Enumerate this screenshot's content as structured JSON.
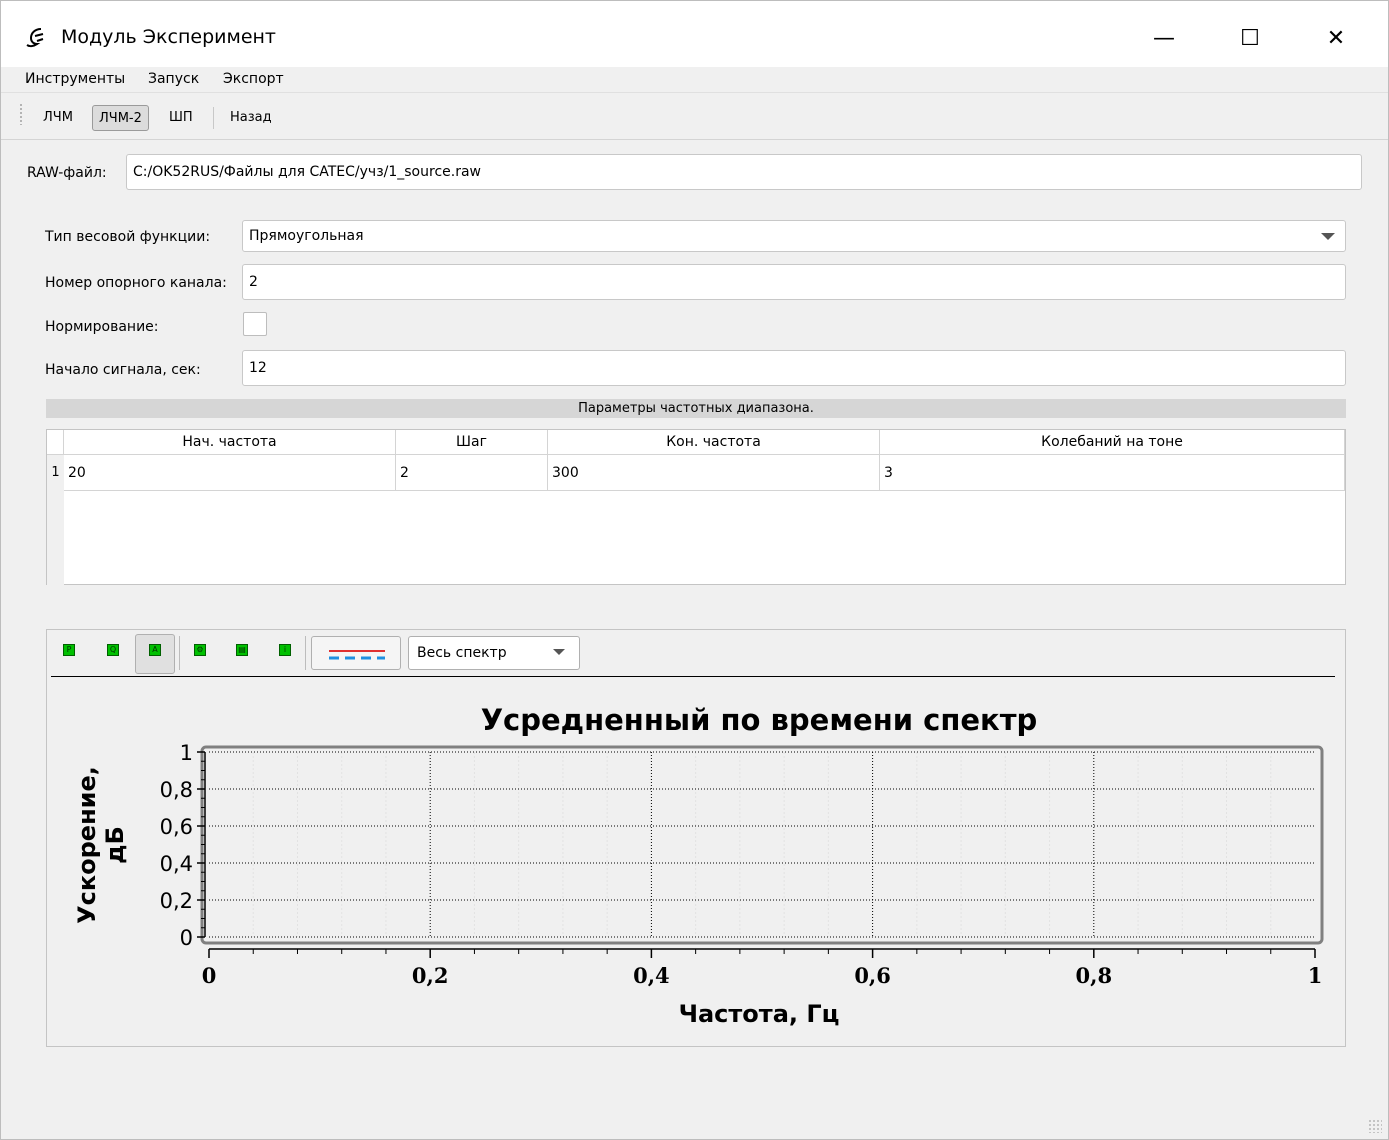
{
  "window": {
    "title": "Модуль Эксперимент",
    "minimize_glyph": "—",
    "maximize_glyph": "☐",
    "close_glyph": "✕"
  },
  "menu": {
    "items": [
      "Инструменты",
      "Запуск",
      "Экспорт"
    ]
  },
  "toolbar": {
    "buttons": [
      "ЛЧМ",
      "ЛЧМ-2",
      "ШП",
      "Назад"
    ],
    "active": "ЛЧМ-2"
  },
  "form": {
    "raw_label": "RAW-файл:",
    "raw_value": "C:/OK52RUS/Файлы для CATEC/учз/1_source.raw",
    "weight_label": "Тип весовой функции:",
    "weight_value": "Прямоугольная",
    "channel_label": "Номер опорного канала:",
    "channel_value": "2",
    "norm_label": "Нормирование:",
    "norm_checked": false,
    "start_label": "Начало сигнала, сек:",
    "start_value": "12"
  },
  "freq_table": {
    "title": "Параметры частотных диапазона.",
    "columns": [
      "Нач. частота",
      "Шаг",
      "Кон. частота",
      "Колебаний на тоне"
    ],
    "rows": [
      {
        "num": "1",
        "cells": [
          "20",
          "2",
          "300",
          "3"
        ]
      }
    ]
  },
  "plot": {
    "tool_icons": [
      "pan-icon",
      "zoom-icon",
      "autoscale-icon",
      "settings-icon",
      "print-icon",
      "info-icon"
    ],
    "legend_icon": "legend-lines-icon",
    "spectrum_mode": "Весь спектр"
  },
  "chart_data": {
    "type": "line",
    "title": "Усредненный по времени спектр",
    "xlabel": "Частота, Гц",
    "ylabel": "Ускорение, дБ",
    "xlim": [
      0,
      1
    ],
    "ylim": [
      0,
      1
    ],
    "xticks": [
      "0",
      "0,2",
      "0,4",
      "0,6",
      "0,8",
      "1"
    ],
    "yticks": [
      "0",
      "0,2",
      "0,4",
      "0,6",
      "0,8",
      "1"
    ],
    "series": [],
    "grid": true
  },
  "colors": {
    "tool_green": "#00c000",
    "legend_red": "#e03030",
    "legend_blue": "#2090e0"
  }
}
